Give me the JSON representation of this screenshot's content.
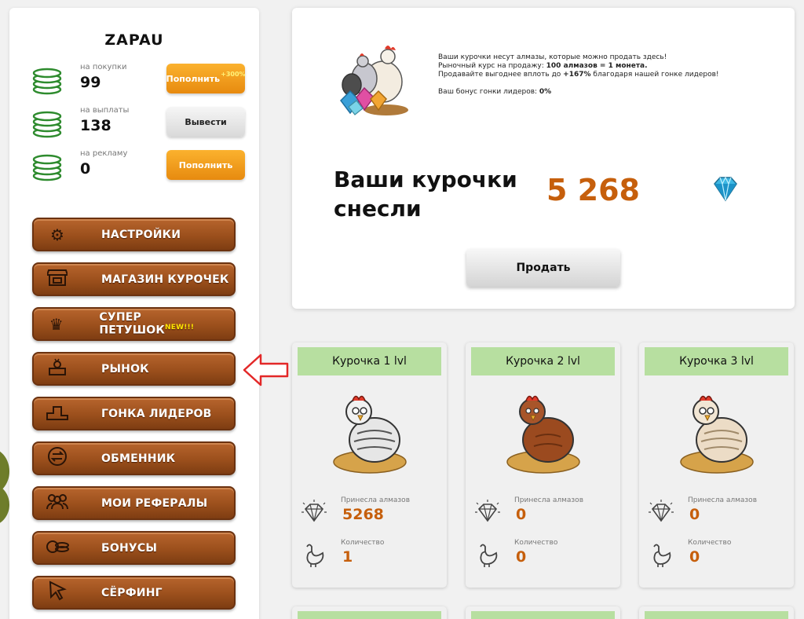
{
  "user": {
    "name": "ZAPAU"
  },
  "balances": [
    {
      "label": "на покупки",
      "value": "99",
      "button": "Пополнить",
      "button_sup": "+300%",
      "style": "orange"
    },
    {
      "label": "на выплаты",
      "value": "138",
      "button": "Вывести",
      "button_sup": "",
      "style": "gray"
    },
    {
      "label": "на рекламу",
      "value": "0",
      "button": "Пополнить",
      "button_sup": "",
      "style": "orange"
    }
  ],
  "menu": [
    {
      "label": "НАСТРОЙКИ",
      "icon": "gear-icon",
      "sup": ""
    },
    {
      "label": "МАГАЗИН КУРОЧЕК",
      "icon": "store-icon",
      "sup": ""
    },
    {
      "label": "СУПЕР ПЕТУШОК",
      "icon": "crown-icon",
      "sup": "NEW!!!"
    },
    {
      "label": "РЫНОК",
      "icon": "market-icon",
      "sup": ""
    },
    {
      "label": "ГОНКА ЛИДЕРОВ",
      "icon": "podium-icon",
      "sup": ""
    },
    {
      "label": "ОБМЕННИК",
      "icon": "exchange-icon",
      "sup": ""
    },
    {
      "label": "МОИ РЕФЕРАЛЫ",
      "icon": "users-icon",
      "sup": ""
    },
    {
      "label": "БОНУСЫ",
      "icon": "coins-icon",
      "sup": ""
    },
    {
      "label": "СЁРФИНГ",
      "icon": "cursor-icon",
      "sup": ""
    }
  ],
  "market": {
    "line1": "Ваши курочки несут алмазы, которые можно продать здесь!",
    "line2_pre": "Рыночный курс на продажу: ",
    "line2_bold": "100 алмазов = 1 монета.",
    "line3_pre": "Продавайте выгоднее вплоть до ",
    "line3_bold": "+167%",
    "line3_post": " благодаря нашей гонке лидеров!",
    "bonus_pre": "Ваш бонус гонки лидеров: ",
    "bonus_value": "0%",
    "laid_title": "Ваши курочки снесли",
    "laid_count": "5 268",
    "sell_button": "Продать"
  },
  "hens": [
    {
      "title": "Курочка 1 lvl",
      "diamonds_label": "Принесла алмазов",
      "diamonds": "5268",
      "qty_label": "Количество",
      "qty": "1",
      "color": "#e6e6e6"
    },
    {
      "title": "Курочка 2 lvl",
      "diamonds_label": "Принесла алмазов",
      "diamonds": "0",
      "qty_label": "Количество",
      "qty": "0",
      "color": "#9b4a1f"
    },
    {
      "title": "Курочка 3 lvl",
      "diamonds_label": "Принесла алмазов",
      "diamonds": "0",
      "qty_label": "Количество",
      "qty": "0",
      "color": "#ecdcc6"
    }
  ],
  "colors": {
    "accent_orange": "#c65f0c",
    "wood": "#9b4f1c",
    "card_header": "#b7dfa0",
    "coin_green": "#2e8b2e"
  }
}
